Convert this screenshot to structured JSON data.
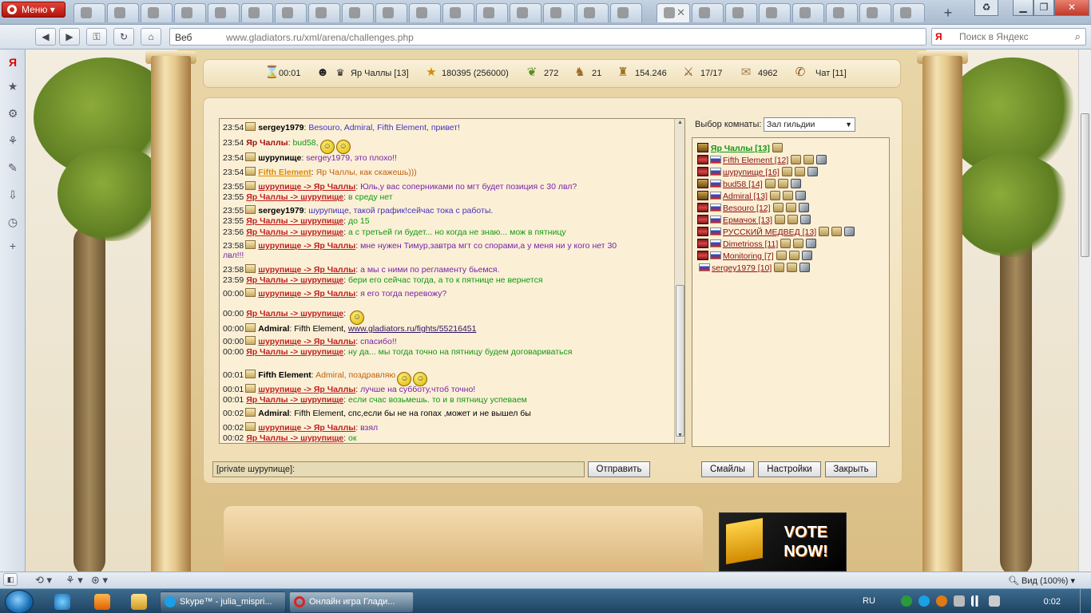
{
  "browser": {
    "menu_label": "Меню",
    "address_prefix": "Веб",
    "url": "www.gladiators.ru/xml/arena/challenges.php",
    "search_engine": "Я",
    "search_placeholder": "Поиск в Яндекс",
    "zoom_label": "Вид (100%)"
  },
  "stats": {
    "timer": "00:01",
    "player": "Яр Чаллы [13]",
    "experience": "180395 (256000)",
    "laurels": "272",
    "eagles": "21",
    "money": "154.246",
    "fights": "17/17",
    "mail": "4962",
    "chat": "Чат [11]"
  },
  "chat": {
    "room_label": "Выбор комнаты:",
    "room_selected": "Зал гильдии",
    "input_value": "[private шурупище]:",
    "send_label": "Отправить",
    "smiles_label": "Смайлы",
    "settings_label": "Настройки",
    "close_label": "Закрыть",
    "messages": [
      {
        "time": "23:54",
        "from": "sergey1979",
        "to": "",
        "text": "Besouro, Admiral, Fifth Element, привет!",
        "color": "blue"
      },
      {
        "time": "23:54",
        "from": "Яр Чаллы",
        "to": "",
        "text": "bud58,",
        "color": "green",
        "mine": true
      },
      {
        "time": "23:54",
        "from": "шурупище",
        "to": "",
        "text": "sergey1979, это плохо!!",
        "color": "purple"
      },
      {
        "time": "23:54",
        "from": "Fifth Element",
        "to": "",
        "text": "Яр Чаллы, как скажешь)))",
        "color": "orange",
        "fe": true
      },
      {
        "time": "23:55",
        "from": "шурупище",
        "to": "Яр Чаллы",
        "text": "Юль,у вас соперниками по мгт будет позиция с 30 лвл?",
        "color": "purple"
      },
      {
        "time": "23:55",
        "from": "Яр Чаллы",
        "to": "шурупище",
        "text": "в среду нет",
        "color": "green"
      },
      {
        "time": "23:55",
        "from": "sergey1979",
        "to": "",
        "text": "шурупище, такой график!сейчас тока с работы.",
        "color": "blue"
      },
      {
        "time": "23:55",
        "from": "Яр Чаллы",
        "to": "шурупище",
        "text": "до 15",
        "color": "green"
      },
      {
        "time": "23:56",
        "from": "Яр Чаллы",
        "to": "шурупище",
        "text": "а с третьей ги будет... но когда не знаю... мож в пятницу",
        "color": "green"
      },
      {
        "time": "23:58",
        "from": "шурупище",
        "to": "Яр Чаллы",
        "text": "мне нужен Тимур,завтра мгт со спорами,а у меня ни у кого нет 30",
        "text2": "лвл!!!",
        "color": "purple"
      },
      {
        "time": "23:58",
        "from": "шурупище",
        "to": "Яр Чаллы",
        "text": "а мы с ними по регламенту бьемся.",
        "color": "purple"
      },
      {
        "time": "23:59",
        "from": "Яр Чаллы",
        "to": "шурупище",
        "text": "бери его сейчас тогда, а то к пятнице не вернется",
        "color": "green"
      },
      {
        "time": "00:00",
        "from": "шурупище",
        "to": "Яр Чаллы",
        "text": "я его тогда перевожу?",
        "color": "purple"
      },
      {
        "time": "00:00",
        "from": "Яр Чаллы",
        "to": "шурупище",
        "text": "",
        "color": "green"
      },
      {
        "time": "00:00",
        "from": "Admiral",
        "to": "",
        "text": "Fifth Element, ",
        "link": "www.gladiators.ru/fights/55216451",
        "color": "black"
      },
      {
        "time": "00:00",
        "from": "шурупище",
        "to": "Яр Чаллы",
        "text": "спасибо!!",
        "color": "purple"
      },
      {
        "time": "00:00",
        "from": "Яр Чаллы",
        "to": "шурупище",
        "text": "ну да... мы тогда точно на пятницу будем договариваться",
        "color": "green"
      },
      {
        "time": "00:01",
        "from": "Fifth Element",
        "to": "",
        "text": "Admiral, поздравляю",
        "color": "orange"
      },
      {
        "time": "00:01",
        "from": "шурупище",
        "to": "Яр Чаллы",
        "text": "лучше на субботу,чтоб точно!",
        "color": "purple"
      },
      {
        "time": "00:01",
        "from": "Яр Чаллы",
        "to": "шурупище",
        "text": "если счас возьмешь. то и в пятницу успеваем",
        "color": "green"
      },
      {
        "time": "00:02",
        "from": "Admiral",
        "to": "",
        "text": "Fifth Element, спс,если бы не на гопах ,может и не вышел бы",
        "color": "black"
      },
      {
        "time": "00:02",
        "from": "шурупище",
        "to": "Яр Чаллы",
        "text": "взял",
        "color": "purple"
      },
      {
        "time": "00:02",
        "from": "Яр Чаллы",
        "to": "шурупище",
        "text": "ок",
        "color": "green"
      }
    ]
  },
  "users": [
    {
      "name": "Яр Чаллы [13]",
      "me": true,
      "clan": "eagle"
    },
    {
      "name": "Fifth Element [12]",
      "clan": "red"
    },
    {
      "name": "шурупище [16]",
      "clan": "red"
    },
    {
      "name": "bud58 [14]",
      "clan": "eagle"
    },
    {
      "name": "Admiral [13]",
      "clan": "eagle"
    },
    {
      "name": "Besouro [12]",
      "clan": "red"
    },
    {
      "name": "Ермачок [13]",
      "clan": "red"
    },
    {
      "name": "РУССКИЙ МЕДВЕД [13]",
      "clan": "red"
    },
    {
      "name": "Dimetrioss [11]",
      "clan": "red"
    },
    {
      "name": "Monitoring [7]",
      "clan": "red"
    },
    {
      "name": "sergey1979 [10]",
      "clan": "none"
    }
  ],
  "vote_banner": {
    "line1": "VOTE",
    "line2": "NOW!"
  },
  "taskbar": {
    "skype_label": "Skype™ - julia_mispri...",
    "opera_label": "Онлайн игра Глади...",
    "language": "RU",
    "clock": "0:02"
  },
  "colors": {
    "purple_text": "#7722aa",
    "green_text": "#119911",
    "private_nick": "#c02020"
  }
}
